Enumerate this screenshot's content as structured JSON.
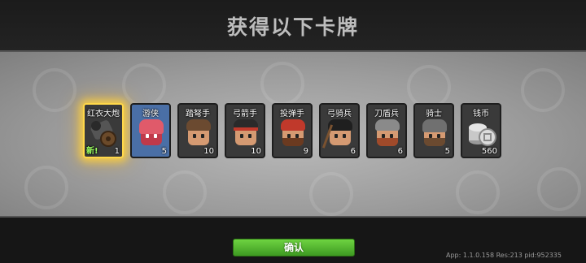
{
  "title": "获得以下卡牌",
  "cards": [
    {
      "name": "红衣大炮",
      "count": "1",
      "new_label": "新!",
      "icon": "cannon-icon"
    },
    {
      "name": "游侠",
      "count": "5",
      "icon": "ranger-portrait"
    },
    {
      "name": "踏弩手",
      "count": "10",
      "icon": "crossbowman-portrait"
    },
    {
      "name": "弓箭手",
      "count": "10",
      "icon": "archer-portrait"
    },
    {
      "name": "投弹手",
      "count": "9",
      "icon": "bomber-portrait"
    },
    {
      "name": "弓骑兵",
      "count": "6",
      "icon": "horse-archer-portrait"
    },
    {
      "name": "刀盾兵",
      "count": "6",
      "icon": "shieldman-portrait"
    },
    {
      "name": "骑士",
      "count": "5",
      "icon": "knight-portrait"
    },
    {
      "name": "钱币",
      "count": "560",
      "icon": "coin-stack-icon"
    }
  ],
  "confirm_label": "确认",
  "version_text": "App: 1.1.0.158 Res:213 pid:952335",
  "colors": {
    "highlight": "#ffd84a",
    "confirm": "#4fb52c"
  }
}
